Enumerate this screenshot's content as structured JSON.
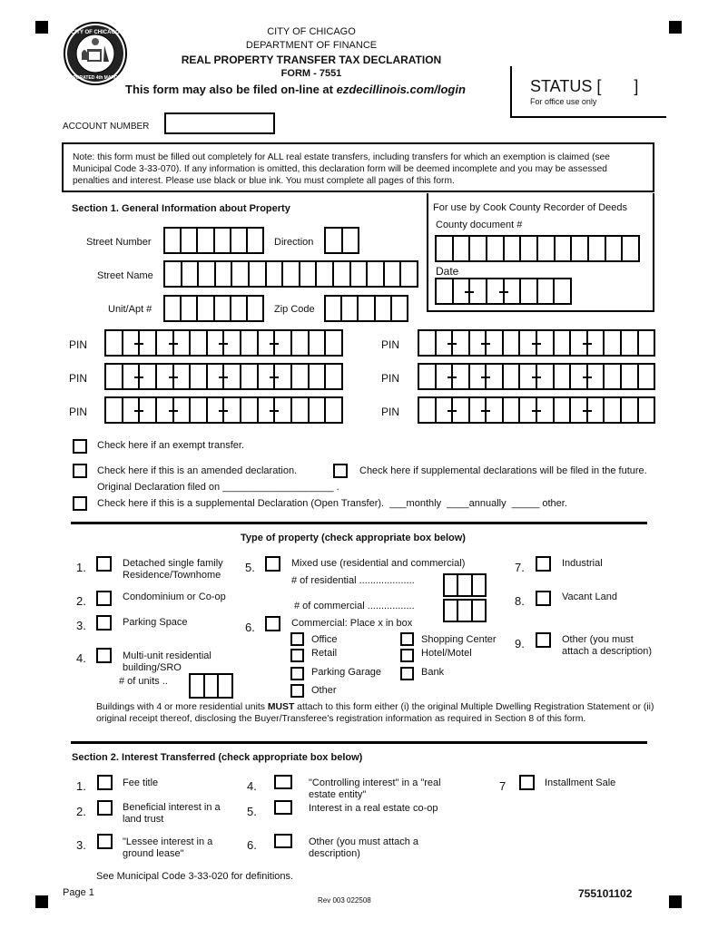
{
  "header": {
    "city": "CITY OF CHICAGO",
    "department": "DEPARTMENT OF FINANCE",
    "form_title": "REAL PROPERTY TRANSFER TAX DECLARATION",
    "form_number": "FORM - 7551",
    "online_prefix": "This form may also be filed on-line at ",
    "online_url": "ezdecillinois.com/login",
    "seal_icon": "city-of-chicago-seal"
  },
  "status": {
    "label": "STATUS [",
    "close": "]",
    "note": "For office use only"
  },
  "account": {
    "label": "ACCOUNT NUMBER",
    "value": ""
  },
  "note": "Note: this form must be filled out completely for ALL real estate transfers, including transfers for which an exemption is claimed (see Municipal Code 3-33-070). If any information is omitted, this declaration form will be deemed incomplete and you may be assessed penalties and interest. Please use black or blue ink. You must complete all pages of this form.",
  "section1": {
    "title": "Section 1. General Information about Property",
    "street_number": "Street Number",
    "direction": "Direction",
    "street_name": "Street Name",
    "unit_apt": "Unit/Apt #",
    "zip_code": "Zip Code",
    "pin_label": "PIN",
    "recorder": {
      "title": "For use by Cook County Recorder of Deeds",
      "county_doc": "County document #",
      "date": "Date"
    },
    "checks": {
      "exempt": "Check here if an exempt transfer.",
      "amended": "Check here if this is an amended declaration.",
      "future_supplemental": "Check here if supplemental declarations will be filed in the future.",
      "original_filed": "Original Declaration filed on ____________________ .",
      "supplemental": "Check here if this is a supplemental Declaration (Open Transfer).  ___monthly  ____annually  _____ other."
    }
  },
  "property_type": {
    "title": "Type of property (check appropriate box below)",
    "items": [
      {
        "num": "1.",
        "label": "Detached single family\nResidence/Townhome"
      },
      {
        "num": "2.",
        "label": "Condominium or Co-op"
      },
      {
        "num": "3.",
        "label": "Parking Space"
      },
      {
        "num": "4.",
        "label": "Multi-unit residential\nbuilding/SRO"
      },
      {
        "num": "5.",
        "label": "Mixed use (residential and commercial)"
      },
      {
        "num": "6.",
        "label": "Commercial: Place x in box"
      },
      {
        "num": "7.",
        "label": "Industrial"
      },
      {
        "num": "8.",
        "label": "Vacant Land"
      },
      {
        "num": "9.",
        "label": "Other (you must\nattach a description)"
      }
    ],
    "units_label": "# of units ..",
    "residential_label": "# of residential ....................",
    "commercial_label": "# of commercial .................",
    "commercial_options": [
      "Office",
      "Retail",
      "Parking Garage",
      "Other",
      "Shopping Center",
      "Hotel/Motel",
      "Bank"
    ],
    "note_pre": "Buildings with 4 or more residential units ",
    "note_bold": "MUST",
    "note_post": " attach to this form either (i) the original Multiple Dwelling Registration Statement or (ii) original receipt thereof, disclosing the Buyer/Transferee's registration information as required in Section 8 of this form."
  },
  "section2": {
    "title": "Section 2. Interest Transferred (check appropriate box below)",
    "items": [
      {
        "num": "1.",
        "label": "Fee title"
      },
      {
        "num": "2.",
        "label": "Beneficial interest in a\nland trust"
      },
      {
        "num": "3.",
        "label": "\"Lessee interest in a\nground lease\""
      },
      {
        "num": "4.",
        "label": "\"Controlling interest\" in a \"real\nestate entity\""
      },
      {
        "num": "5.",
        "label": "Interest in a real estate co-op"
      },
      {
        "num": "6.",
        "label": "Other (you must attach a\ndescription)"
      },
      {
        "num": "7",
        "label": "Installment Sale"
      }
    ],
    "definitions": "See Municipal Code 3-33-020 for definitions."
  },
  "footer": {
    "page": "Page 1",
    "revision": "Rev 003 022508",
    "form_code": "755101102"
  }
}
